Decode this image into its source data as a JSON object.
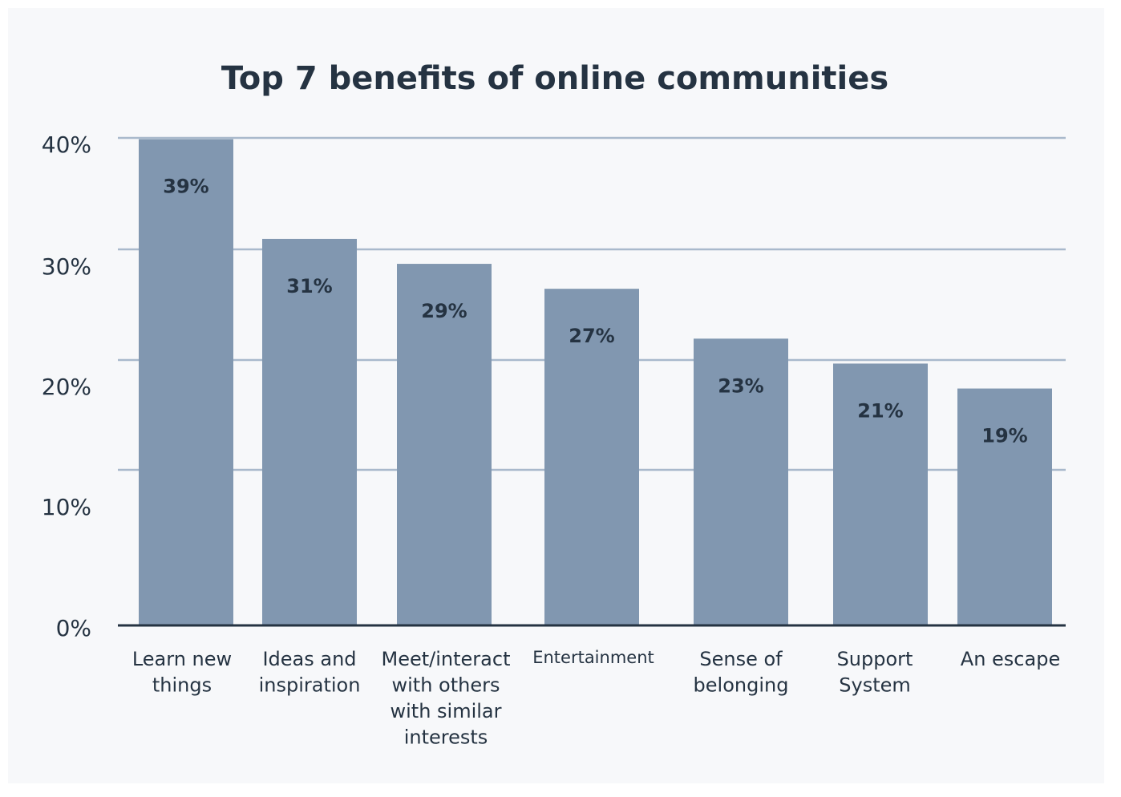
{
  "chart_data": {
    "type": "bar",
    "title": "Top 7 benefits of online communities",
    "xlabel": "",
    "ylabel": "",
    "ylim": [
      0,
      40
    ],
    "grid": true,
    "legend": "none",
    "y_ticks": [
      "0%",
      "10%",
      "20%",
      "30%",
      "40%"
    ],
    "categories": [
      [
        "Learn new",
        "things"
      ],
      [
        "Ideas and",
        "inspiration"
      ],
      [
        "Meet/interact",
        "with others",
        "with similar",
        "interests"
      ],
      [
        "Entertainment"
      ],
      [
        "Sense of",
        "belonging"
      ],
      [
        "Support",
        "System"
      ],
      [
        "An escape"
      ]
    ],
    "values": [
      39,
      31,
      29,
      27,
      23,
      21,
      19
    ],
    "data_labels": [
      "39%",
      "31%",
      "29%",
      "27%",
      "23%",
      "21%",
      "19%"
    ],
    "colors": {
      "bar": "#8197b0",
      "grid": "#a9b9cc",
      "axis": "#253342",
      "text": "#253342",
      "background": "#f7f8fa"
    }
  }
}
